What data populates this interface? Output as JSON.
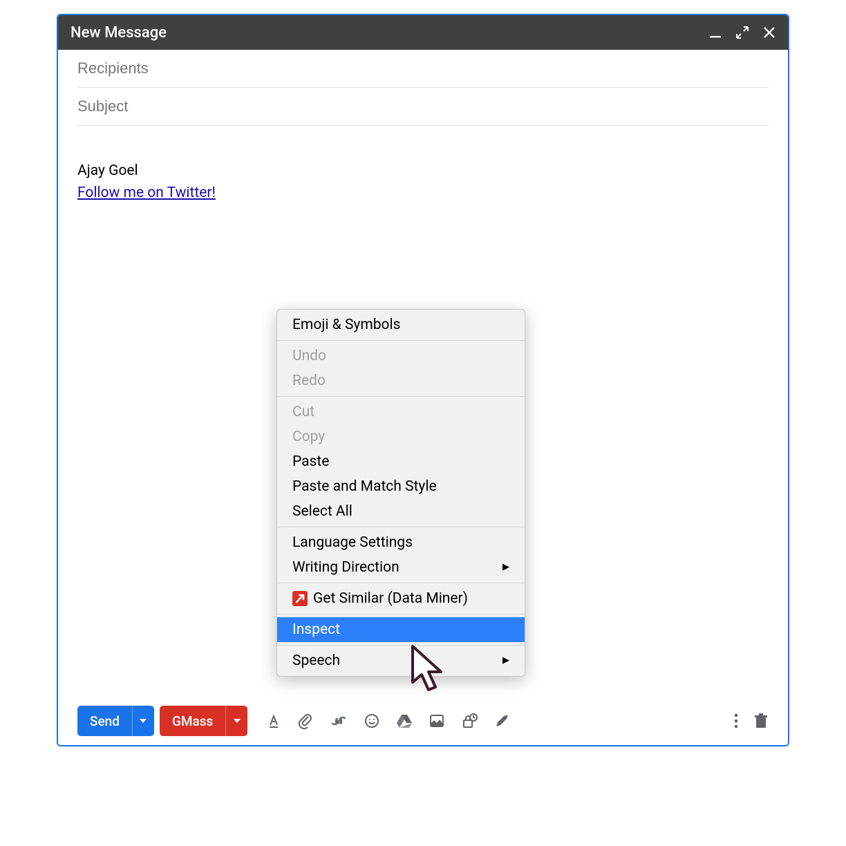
{
  "window": {
    "title": "New Message"
  },
  "fields": {
    "recipients_placeholder": "Recipients",
    "subject_placeholder": "Subject"
  },
  "signature": {
    "name": "Ajay Goel",
    "link_text": "Follow me on Twitter!"
  },
  "contextmenu": {
    "emoji": "Emoji & Symbols",
    "undo": "Undo",
    "redo": "Redo",
    "cut": "Cut",
    "copy": "Copy",
    "paste": "Paste",
    "paste_match": "Paste and Match Style",
    "select_all": "Select All",
    "language": "Language Settings",
    "writing_dir": "Writing Direction",
    "get_similar": "Get Similar (Data Miner)",
    "inspect": "Inspect",
    "speech": "Speech"
  },
  "buttons": {
    "send": "Send",
    "gmass": "GMass"
  }
}
